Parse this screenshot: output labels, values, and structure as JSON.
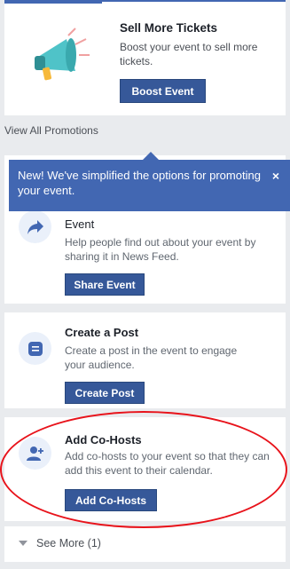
{
  "promo": {
    "title": "Sell More Tickets",
    "description": "Boost your event to sell more tickets.",
    "button_label": "Boost Event"
  },
  "view_all_label": "View All Promotions",
  "tooltip": {
    "text": "New! We've simplified the options for promoting your event.",
    "close_label": "×"
  },
  "share": {
    "title": "Event",
    "description": "Help people find out about your event by sharing it in News Feed.",
    "button_label": "Share Event"
  },
  "post": {
    "title": "Create a Post",
    "description": "Create a post in the event to engage your audience.",
    "button_label": "Create Post"
  },
  "cohost": {
    "title": "Add Co-Hosts",
    "description": "Add co-hosts to your event so that they can add this event to their calendar.",
    "button_label": "Add Co-Hosts"
  },
  "see_more_label": "See More (1)",
  "icons": {
    "promo": "megaphone-icon",
    "share": "share-arrow-icon",
    "post": "post-icon",
    "cohost": "add-person-icon"
  },
  "colors": {
    "brand": "#4267b2",
    "button": "#365899",
    "annotation": "#e8131b"
  }
}
